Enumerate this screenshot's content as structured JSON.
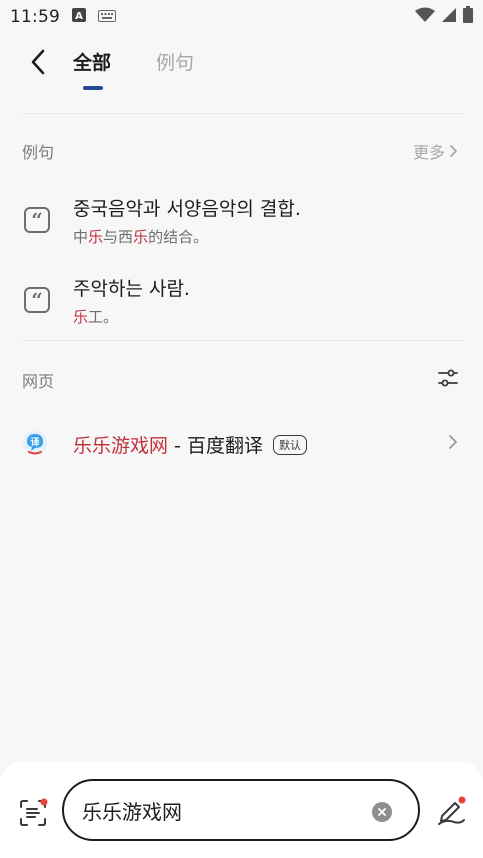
{
  "status": {
    "time": "11:59"
  },
  "tabs": [
    {
      "label": "全部",
      "active": true
    },
    {
      "label": "例句",
      "active": false
    }
  ],
  "examples_section": {
    "title": "例句",
    "more_label": "更多",
    "items": [
      {
        "sentence": "중국음악과 서양음악의 결합.",
        "translation_parts": [
          "中",
          "乐",
          "与西",
          "乐",
          "的结合。"
        ]
      },
      {
        "sentence": "주악하는 사람.",
        "translation_parts": [
          "乐",
          "工。"
        ]
      }
    ]
  },
  "web_section": {
    "title": "网页",
    "result": {
      "keyword": "乐乐游戏网",
      "suffix": " - 百度翻译",
      "badge": "默认"
    }
  },
  "search": {
    "value": "乐乐游戏网"
  },
  "colors": {
    "highlight": "#c0313a",
    "accent": "#2c4a9c",
    "notification_dot": "#e8403a"
  }
}
